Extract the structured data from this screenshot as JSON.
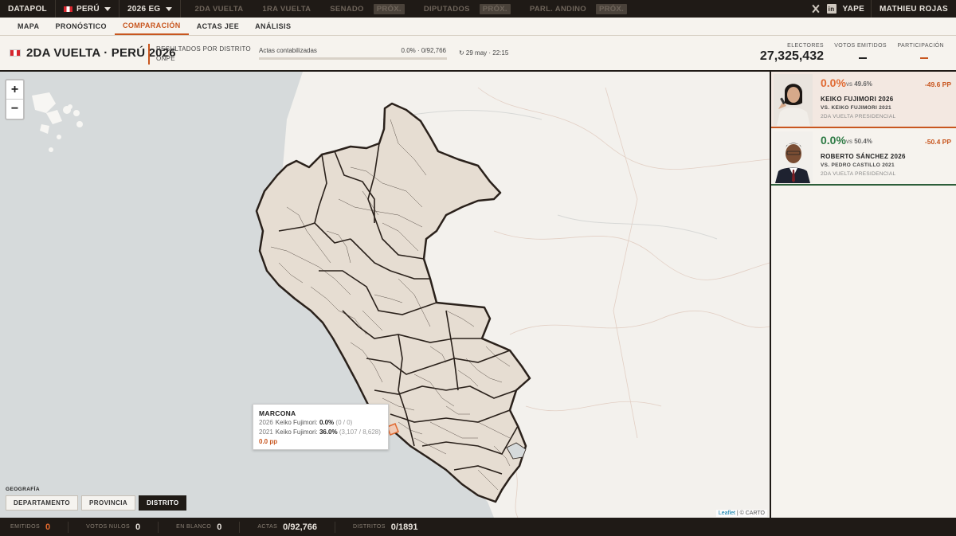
{
  "topbar": {
    "brand": "DATAPOL",
    "country": "PERÚ",
    "election": "2026 EG",
    "nav": [
      {
        "label": "2DA VUELTA",
        "active": true,
        "prox": ""
      },
      {
        "label": "1RA VUELTA",
        "active": false,
        "prox": ""
      },
      {
        "label": "SENADO",
        "active": false,
        "prox": "PRÓX."
      },
      {
        "label": "DIPUTADOS",
        "active": false,
        "prox": "PRÓX."
      },
      {
        "label": "PARL. ANDINO",
        "active": false,
        "prox": "PRÓX."
      }
    ],
    "yape": "YAPE",
    "author": "MATHIEU ROJAS"
  },
  "subnav": {
    "tabs": [
      "MAPA",
      "PRONÓSTICO",
      "COMPARACIÓN",
      "ACTAS JEE",
      "ANÁLISIS"
    ],
    "active": "COMPARACIÓN"
  },
  "header": {
    "title": "2DA VUELTA · PERÚ 2026",
    "source_line1": "RESULTADOS POR DISTRITO",
    "source_line2": "ONPE",
    "actas_label": "Actas contabilizadas",
    "actas_value": "0.0% · 0/92,766",
    "actas_progress": 0.0,
    "time": "↻ 29 may · 22:15",
    "electores_label": "ELECTORES",
    "electores_value": "27,325,432",
    "votos_label": "VOTOS EMITIDOS",
    "participacion_label": "PARTICIPACIÓN"
  },
  "map": {
    "zoom_in": "+",
    "zoom_out": "−",
    "tooltip": {
      "name": "MARCONA",
      "year1": "2026",
      "line1_label": "Keiko Fujimori:",
      "line1_value": "0.0%",
      "line1_detail": "(0 / 0)",
      "year2": "2021",
      "line2_label": "Keiko Fujimori:",
      "line2_value": "36.0%",
      "line2_detail": "(3,107 / 8,628)",
      "pp": "0.0 pp"
    },
    "geo_label": "GEOGRAFÍA",
    "geo_buttons": [
      "DEPARTAMENTO",
      "PROVINCIA",
      "DISTRITO"
    ],
    "geo_active": "DISTRITO",
    "attribution_leaflet": "Leaflet",
    "attribution_rest": "| © CARTO"
  },
  "panel": {
    "cards": [
      {
        "pct": "0.0%",
        "vs": "vs",
        "vs_pct": "49.6%",
        "delta": "-49.6 PP",
        "candidate": "KEIKO FUJIMORI 2026",
        "vs_name": "VS. KEIKO FUJIMORI 2021",
        "election": "2DA VUELTA PRESIDENCIAL"
      },
      {
        "pct": "0.0%",
        "vs": "vs",
        "vs_pct": "50.4%",
        "delta": "-50.4 PP",
        "candidate": "ROBERTO SÁNCHEZ 2026",
        "vs_name": "VS. PEDRO CASTILLO 2021",
        "election": "2DA VUELTA PRESIDENCIAL"
      }
    ]
  },
  "bottombar": {
    "emitidos_label": "EMITIDOS",
    "emitidos_value": "0",
    "nulos_label": "VOTOS NULOS",
    "nulos_value": "0",
    "blanco_label": "EN BLANCO",
    "blanco_value": "0",
    "actas_label": "ACTAS",
    "actas_value": "0/92,766",
    "distritos_label": "DISTRITOS",
    "distritos_value": "0/1891"
  },
  "colors": {
    "accent": "#c8561f",
    "dark": "#1f1a16",
    "green": "#2d7a44",
    "region_fill": "#e6ddd2",
    "ocean": "#d6dadb"
  }
}
